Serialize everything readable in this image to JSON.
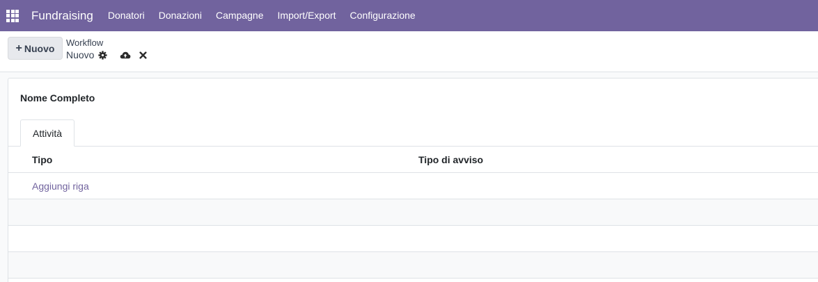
{
  "navbar": {
    "brand": "Fundraising",
    "menu": [
      "Donatori",
      "Donazioni",
      "Campagne",
      "Import/Export",
      "Configurazione"
    ],
    "color": "#71639e"
  },
  "control_panel": {
    "new_button_label": "Nuovo",
    "breadcrumb_parent": "Workflow",
    "record_name": "Nuovo"
  },
  "form": {
    "field_label": "Nome Completo",
    "tab_label": "Attività",
    "columns": [
      "Tipo",
      "Tipo di avviso"
    ],
    "add_line_label": "Aggiungi riga"
  },
  "icons": [
    "apps-grid-icon",
    "plus-icon",
    "gear-icon",
    "cloud-upload-icon",
    "close-icon"
  ]
}
